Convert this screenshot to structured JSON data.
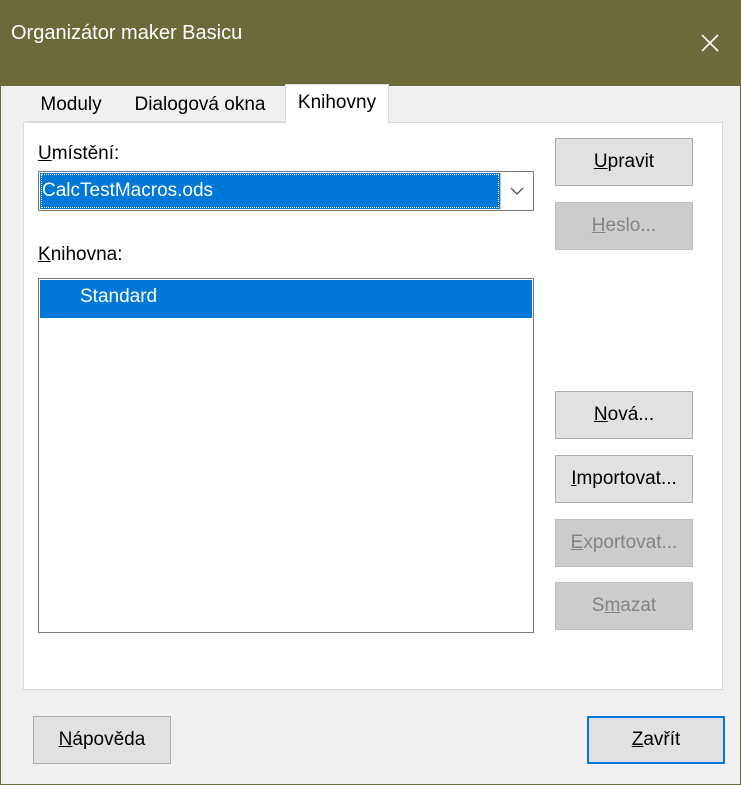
{
  "window": {
    "title": "Organizátor maker Basicu",
    "close_icon": "close-icon"
  },
  "tabs": [
    {
      "label": "Moduly",
      "active": false
    },
    {
      "label": "Dialogová okna",
      "active": false
    },
    {
      "label": "Knihovny",
      "active": true
    }
  ],
  "location": {
    "label_mnemonic": "U",
    "label_rest": "místění:",
    "value": "CalcTestMacros.ods",
    "dropdown_icon": "chevron-down-icon"
  },
  "library": {
    "label_mnemonic": "K",
    "label_rest": "nihovna:",
    "items": [
      {
        "label": "Standard",
        "selected": true
      }
    ]
  },
  "buttons": {
    "edit": {
      "mnemonic": "U",
      "rest": "pravit",
      "enabled": true
    },
    "password": {
      "mnemonic": "H",
      "rest": "eslo...",
      "enabled": false
    },
    "new": {
      "mnemonic": "N",
      "rest": "ová...",
      "enabled": true
    },
    "import": {
      "mnemonic": "I",
      "rest": "mportovat...",
      "enabled": true
    },
    "export": {
      "mnemonic": "E",
      "rest": "xportovat...",
      "enabled": false
    },
    "delete": {
      "pre": "S",
      "mnemonic": "m",
      "rest": "azat",
      "enabled": false
    }
  },
  "footer": {
    "help": {
      "mnemonic": "N",
      "rest": "ápověda"
    },
    "close": {
      "mnemonic": "Z",
      "rest": "avřít"
    }
  },
  "colors": {
    "titlebar": "#6b6a3a",
    "selection": "#0078d7"
  }
}
